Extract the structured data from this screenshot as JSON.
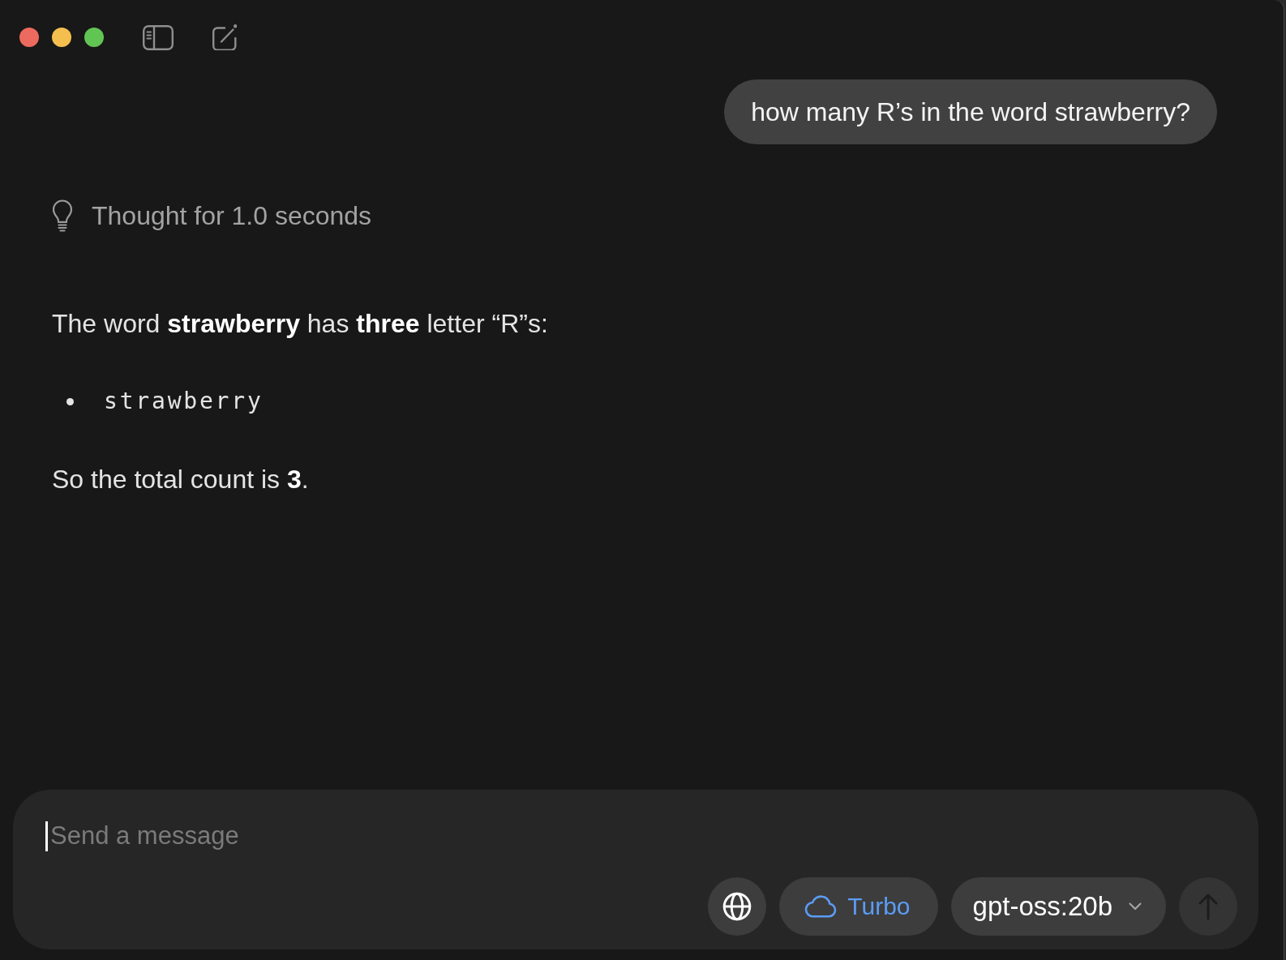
{
  "window": {
    "controls": [
      {
        "color": "#ed6a5e"
      },
      {
        "color": "#f5bf4f"
      },
      {
        "color": "#61c554"
      }
    ]
  },
  "conversation": [
    {
      "kind": "user",
      "text": "how many R’s in the word strawberry?"
    },
    {
      "kind": "assistant",
      "thought": "Thought for 1.0 seconds",
      "content": [
        {
          "kind": "paragraph",
          "text": "The word **strawberry** has **three** letter “R”s:"
        },
        {
          "kind": "bullets",
          "items": [
            {
              "kind": "code",
              "text": "strawberry"
            }
          ]
        },
        {
          "kind": "paragraph",
          "text": "So the total count is **3**."
        }
      ]
    }
  ],
  "composer": {
    "placeholder": "Send a message",
    "focused": true,
    "turbo": {
      "label": "Turbo",
      "on": true
    },
    "model": {
      "value": "gpt-oss:20b"
    },
    "send": {
      "disabled": true
    }
  }
}
